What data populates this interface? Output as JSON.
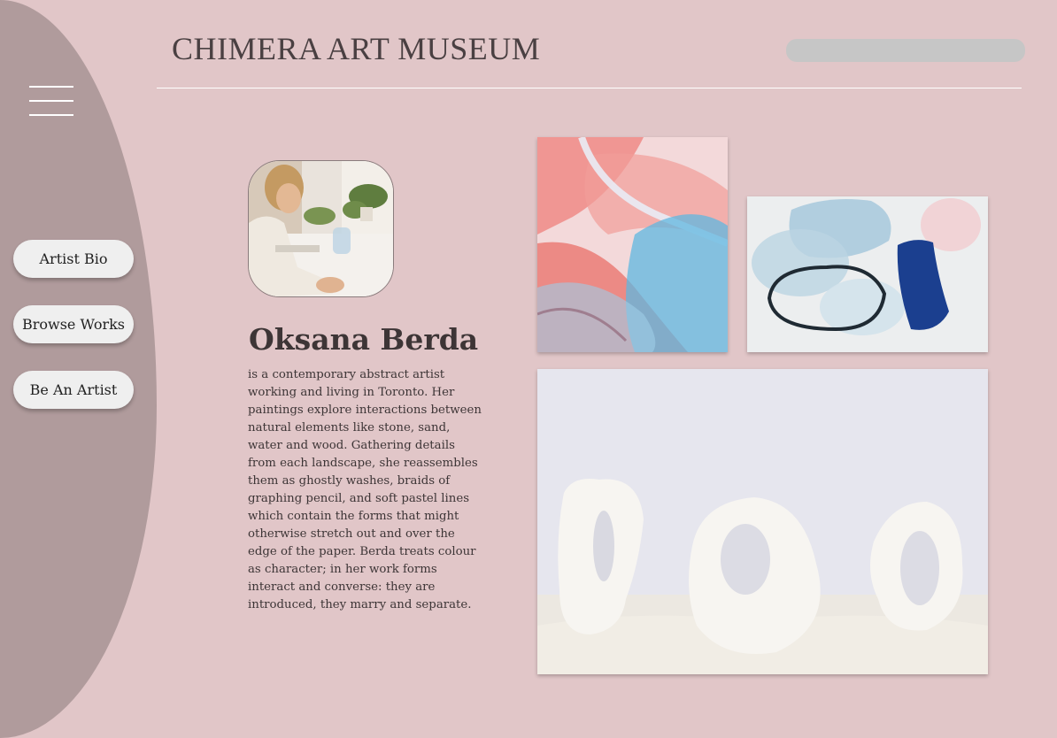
{
  "header": {
    "title": "CHIMERA ART MUSEUM"
  },
  "search": {
    "placeholder": ""
  },
  "nav": {
    "artist_bio": "Artist Bio",
    "browse_works": "Browse Works",
    "be_an_artist": "Be An Artist"
  },
  "artist": {
    "name": "Oksana Berda",
    "bio": " is a contemporary abstract artist working and living in Toronto. Her paintings explore interactions between natural elements like stone, sand, water and wood. Gathering details from each landscape, she reassembles them as ghostly washes, braids of graphing pencil, and soft pastel lines which contain the forms that might otherwise stretch out and over the edge of the paper. Berda treats colour as character; in her work forms interact and converse: they are introduced, they marry and separate."
  },
  "icons": {
    "menu": "hamburger-menu-icon"
  },
  "colors": {
    "background": "#e1c6c8",
    "sidebar": "#b09b9c",
    "button": "#efefef"
  }
}
